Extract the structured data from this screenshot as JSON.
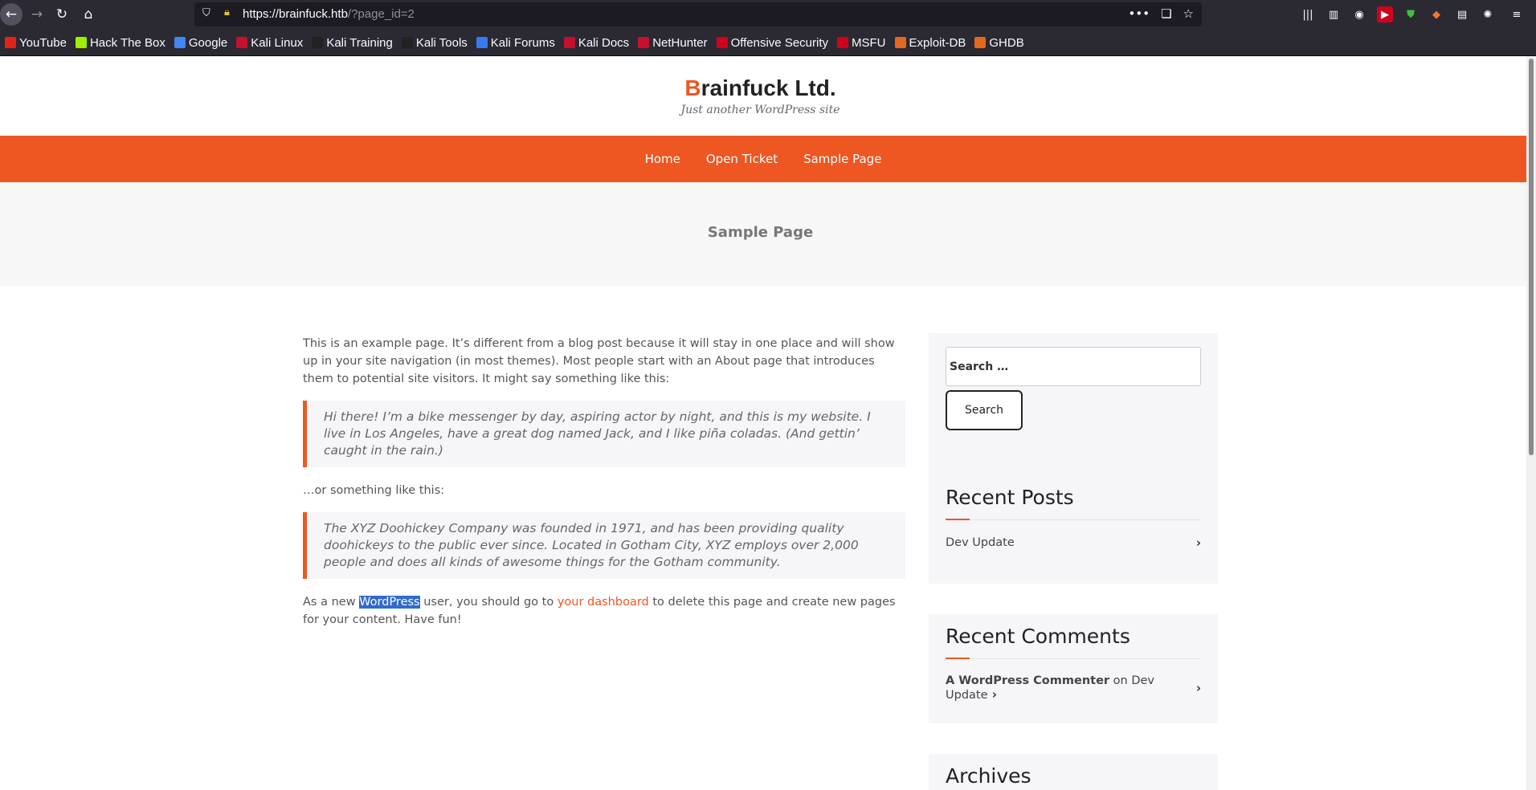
{
  "browser": {
    "url_host": "https://brainfuck.htb",
    "url_path": "/?page_id=2",
    "url_actions": [
      "•••",
      "❏",
      "☆"
    ],
    "bookmarks": [
      {
        "label": "YouTube",
        "color": "#e62117"
      },
      {
        "label": "Hack The Box",
        "color": "#9fef00"
      },
      {
        "label": "Google",
        "color": "#4285f4"
      },
      {
        "label": "Kali Linux",
        "color": "#c8102e"
      },
      {
        "label": "Kali Training",
        "color": "#222222"
      },
      {
        "label": "Kali Tools",
        "color": "#222222"
      },
      {
        "label": "Kali Forums",
        "color": "#367bf0"
      },
      {
        "label": "Kali Docs",
        "color": "#c8102e"
      },
      {
        "label": "NetHunter",
        "color": "#c8102e"
      },
      {
        "label": "Offensive Security",
        "color": "#d0021b"
      },
      {
        "label": "MSFU",
        "color": "#d0021b"
      },
      {
        "label": "Exploit-DB",
        "color": "#e5671d"
      },
      {
        "label": "GHDB",
        "color": "#e5671d"
      }
    ]
  },
  "site": {
    "title_first": "B",
    "title_rest": "rainfuck Ltd.",
    "tagline": "Just another WordPress site",
    "nav": [
      "Home",
      "Open Ticket",
      "Sample Page"
    ],
    "page_title": "Sample Page",
    "accent": "#ee5622"
  },
  "content": {
    "p1": "This is an example page. It’s different from a blog post because it will stay in one place and will show up in your site navigation (in most themes). Most people start with an About page that introduces them to potential site visitors. It might say something like this:",
    "quote1": "Hi there! I’m a bike messenger by day, aspiring actor by night, and this is my website. I live in Los Angeles, have a great dog named Jack, and I like piña coladas. (And gettin’ caught in the rain.)",
    "p2": "…or something like this:",
    "quote2": "The XYZ Doohickey Company was founded in 1971, and has been providing quality doohickeys to the public ever since. Located in Gotham City, XYZ employs over 2,000 people and does all kinds of awesome things for the Gotham community.",
    "p3_a": "As a new ",
    "p3_sel": "WordPress",
    "p3_b": " user, you should go to ",
    "p3_link": "your dashboard",
    "p3_c": " to delete this page and create new pages for your content. Have fun!"
  },
  "sidebar": {
    "search_placeholder": "Search …",
    "search_button": "Search",
    "recent_posts_title": "Recent Posts",
    "recent_posts": [
      "Dev Update"
    ],
    "recent_comments_title": "Recent Comments",
    "comment_author": "A WordPress Commenter",
    "comment_on": " on ",
    "comment_post": "Dev Update",
    "archives_title": "Archives"
  }
}
